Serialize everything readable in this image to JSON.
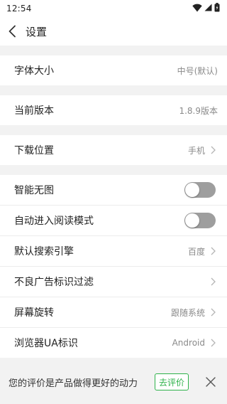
{
  "status_bar": {
    "time": "12:54",
    "icons": [
      "wifi-icon",
      "signal-icon",
      "battery-icon"
    ]
  },
  "header": {
    "back_icon": "chevron-left-icon",
    "title": "设置"
  },
  "settings": {
    "font_size": {
      "label": "字体大小",
      "value": "中号(默认)"
    },
    "version": {
      "label": "当前版本",
      "value": "1.8.9版本"
    },
    "download_location": {
      "label": "下载位置",
      "value": "手机"
    },
    "smart_no_image": {
      "label": "智能无图",
      "enabled": false
    },
    "auto_reading_mode": {
      "label": "自动进入阅读模式",
      "enabled": false
    },
    "default_search_engine": {
      "label": "默认搜索引擎",
      "value": "百度"
    },
    "ad_filter": {
      "label": "不良广告标识过滤"
    },
    "screen_rotation": {
      "label": "屏幕旋转",
      "value": "跟随系统"
    },
    "browser_ua": {
      "label": "浏览器UA标识",
      "value": "Android"
    }
  },
  "banner": {
    "message": "您的评价是产品做得更好的动力",
    "rate_button": "去评价",
    "close_icon": "close-icon"
  },
  "colors": {
    "accent_green": "#2eb24a",
    "toggle_off": "#9e9e9e",
    "background": "#f2f2f2"
  }
}
